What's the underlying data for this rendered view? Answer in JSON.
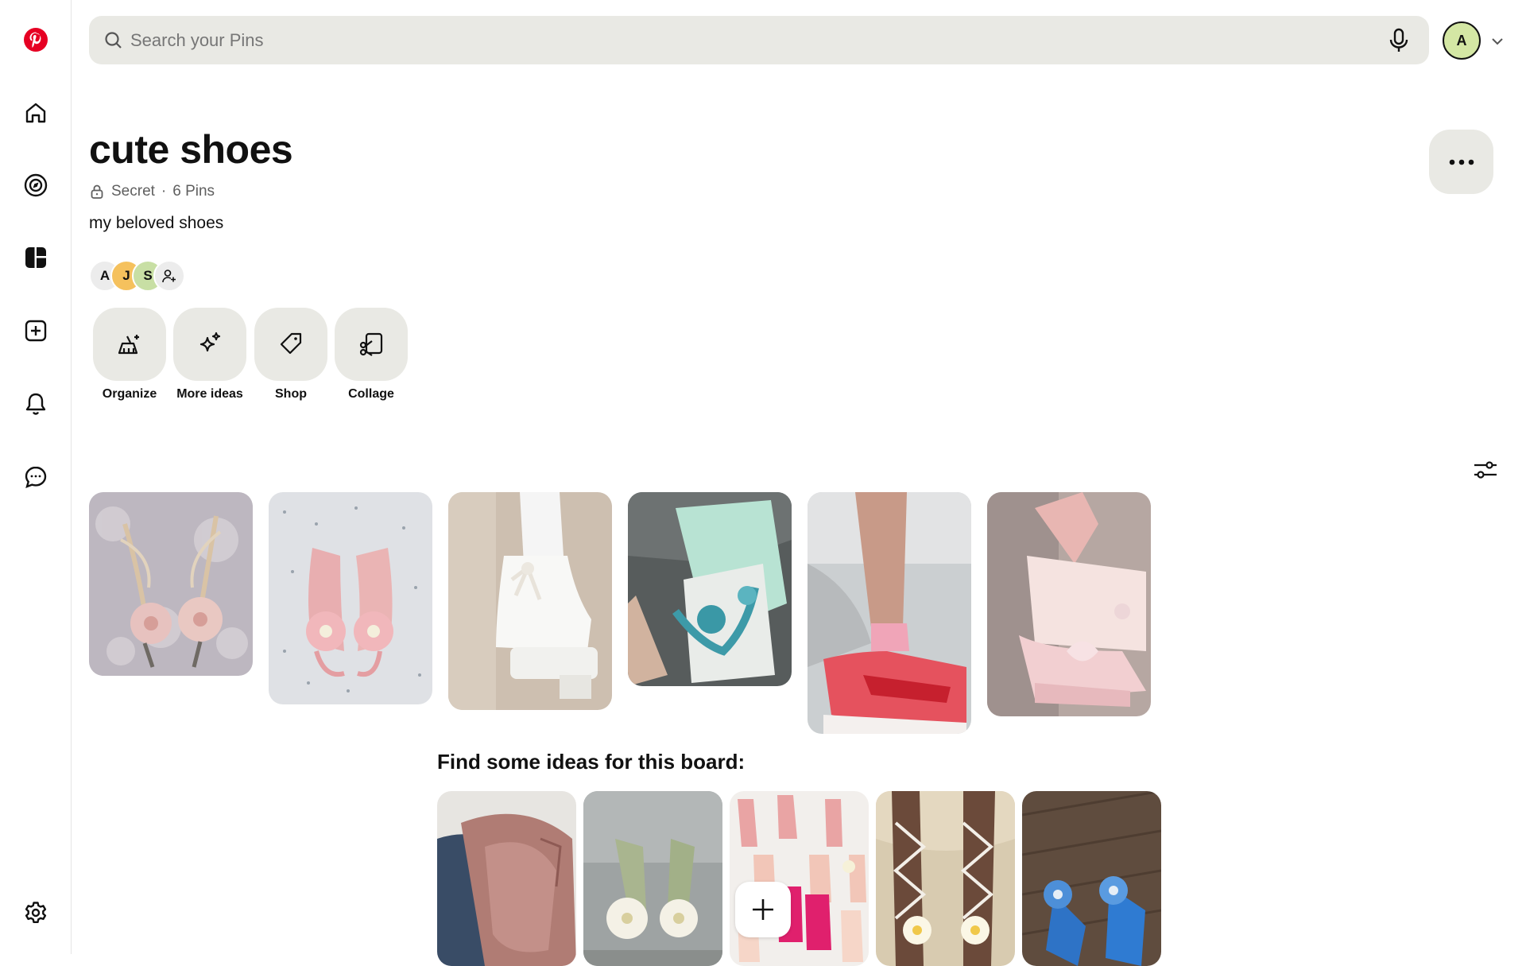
{
  "search": {
    "placeholder": "Search your Pins"
  },
  "account": {
    "initial": "A"
  },
  "board": {
    "title": "cute shoes",
    "privacy": "Secret",
    "separator": "·",
    "pin_count": "6 Pins",
    "description": "my beloved shoes"
  },
  "collaborators": [
    {
      "initial": "A",
      "color": "#ececec"
    },
    {
      "initial": "J",
      "color": "#f5c15d"
    },
    {
      "initial": "S",
      "color": "#c8dfa4"
    }
  ],
  "actions": {
    "organize": "Organize",
    "more_ideas": "More ideas",
    "shop": "Shop",
    "collage": "Collage"
  },
  "ideas": {
    "heading": "Find some ideas for this board:"
  },
  "icons": {
    "logo": "pinterest-logo",
    "home": "home-icon",
    "explore": "compass-icon",
    "boards": "boards-icon",
    "create": "create-icon",
    "notifications": "bell-icon",
    "messages": "chat-icon",
    "settings": "gear-icon"
  },
  "colors": {
    "brand": "#e60023",
    "surface": "#e9e9e4"
  }
}
